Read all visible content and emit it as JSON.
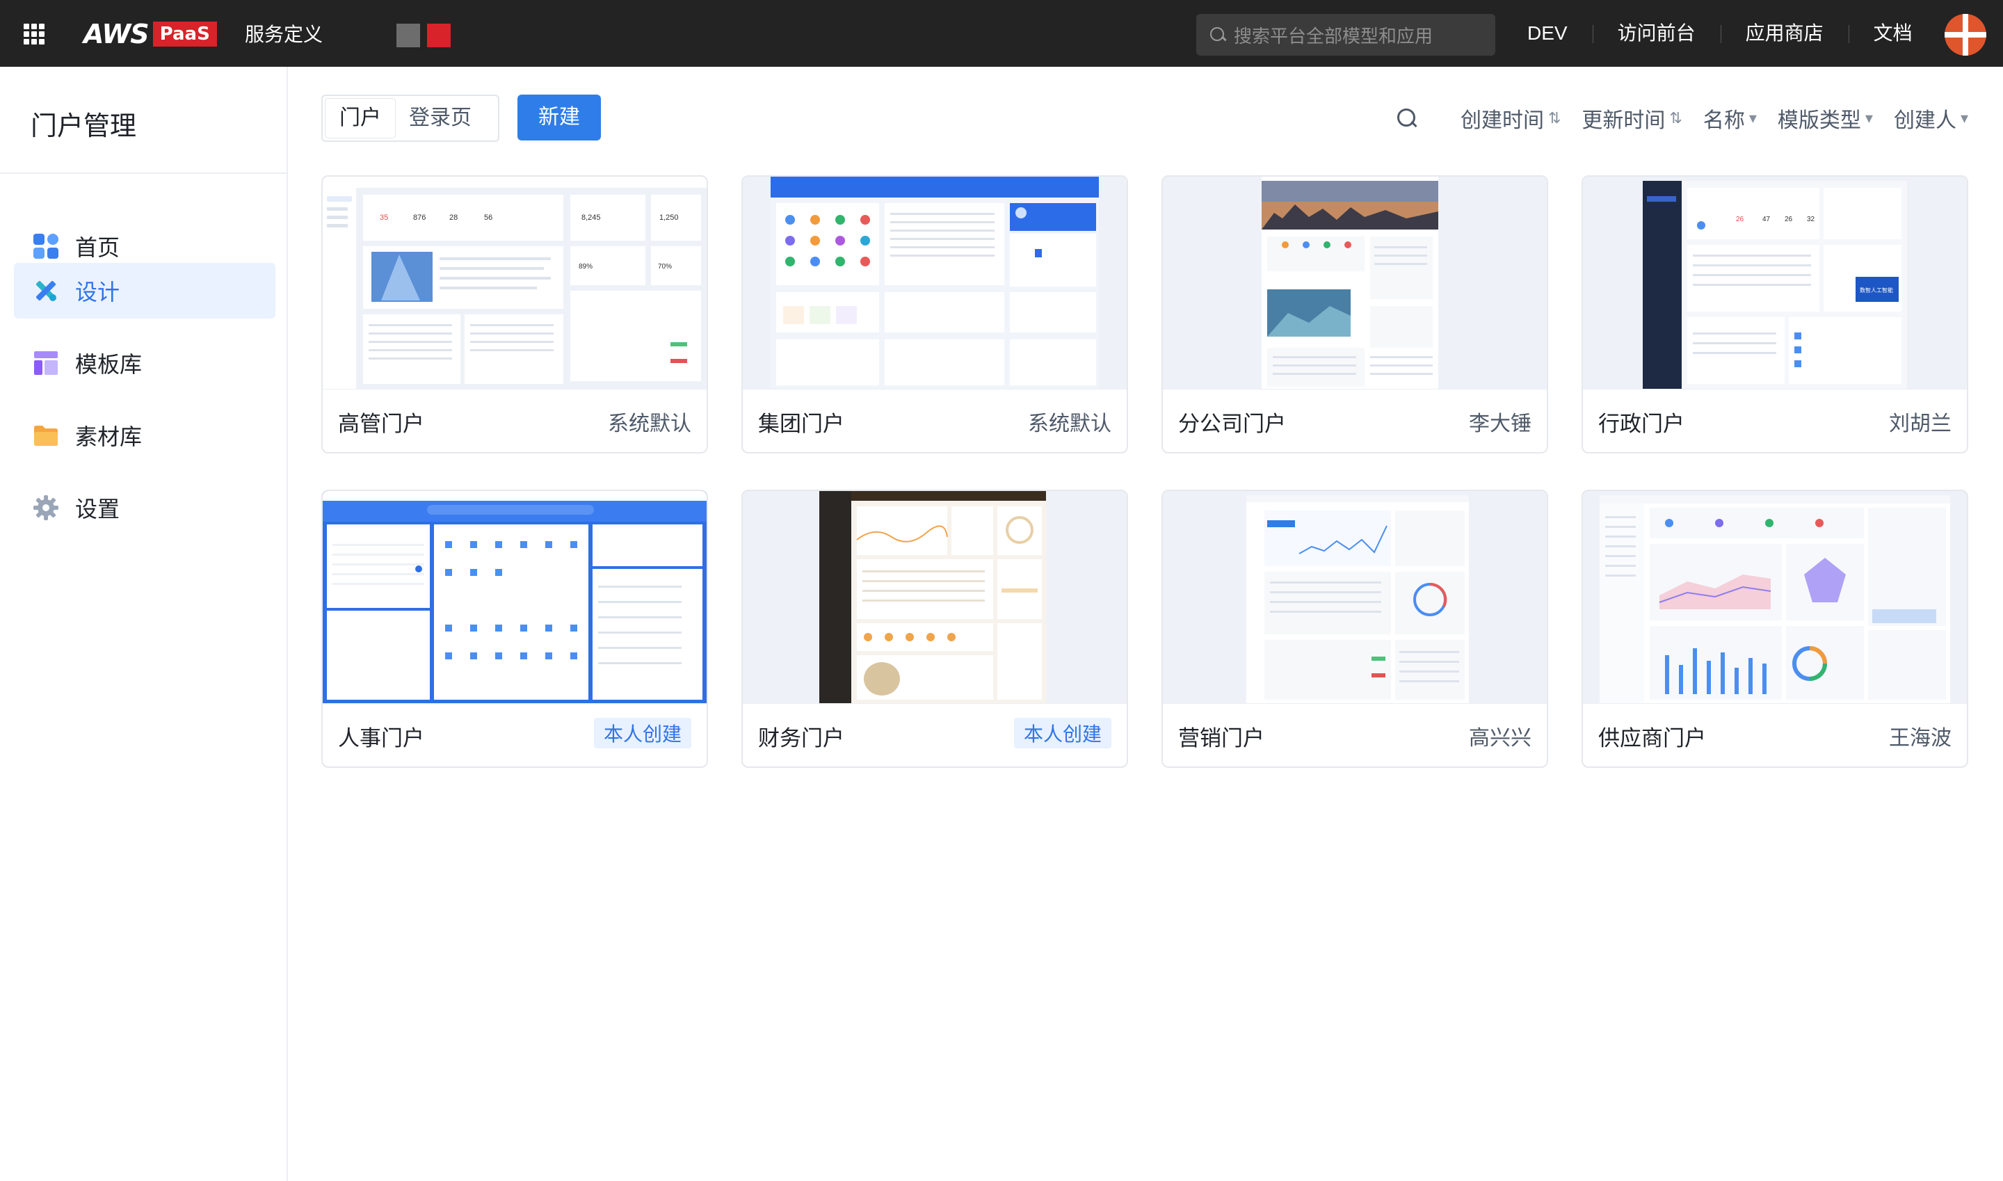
{
  "topbar": {
    "logo_brand": "AWS",
    "logo_badge": "PaaS",
    "app_title": "服务定义",
    "search_placeholder": "搜索平台全部模型和应用",
    "links": [
      "DEV",
      "访问前台",
      "应用商店",
      "文档"
    ]
  },
  "sidebar": {
    "title": "门户管理",
    "items": [
      {
        "label": "首页",
        "icon": "home-grid-icon"
      },
      {
        "label": "设计",
        "icon": "design-tools-icon",
        "active": true
      },
      {
        "label": "模板库",
        "icon": "template-icon"
      },
      {
        "label": "素材库",
        "icon": "folder-icon"
      },
      {
        "label": "设置",
        "icon": "gear-icon"
      }
    ]
  },
  "toolbar": {
    "tabs": [
      "门户",
      "登录页"
    ],
    "selected_tab": "门户",
    "new_label": "新建",
    "sort_options": [
      {
        "label": "创建时间",
        "indicator": "⇅"
      },
      {
        "label": "更新时间",
        "indicator": "⇅"
      },
      {
        "label": "名称",
        "indicator": "▾"
      },
      {
        "label": "模版类型",
        "indicator": "▾"
      },
      {
        "label": "创建人",
        "indicator": "▾"
      }
    ]
  },
  "portals": [
    {
      "name": "高管门户",
      "owner": "系统默认",
      "owner_is_tag": false
    },
    {
      "name": "集团门户",
      "owner": "系统默认",
      "owner_is_tag": false
    },
    {
      "name": "分公司门户",
      "owner": "李大锤",
      "owner_is_tag": false
    },
    {
      "name": "行政门户",
      "owner": "刘胡兰",
      "owner_is_tag": false
    },
    {
      "name": "人事门户",
      "owner": "本人创建",
      "owner_is_tag": true
    },
    {
      "name": "财务门户",
      "owner": "本人创建",
      "owner_is_tag": true
    },
    {
      "name": "营销门户",
      "owner": "高兴兴",
      "owner_is_tag": false
    },
    {
      "name": "供应商门户",
      "owner": "王海波",
      "owner_is_tag": false
    }
  ],
  "colors": {
    "topbar_bg": "#232323",
    "accent": "#2f7de8",
    "brand_red": "#d8232a",
    "active_bg": "#eaf2ff"
  }
}
